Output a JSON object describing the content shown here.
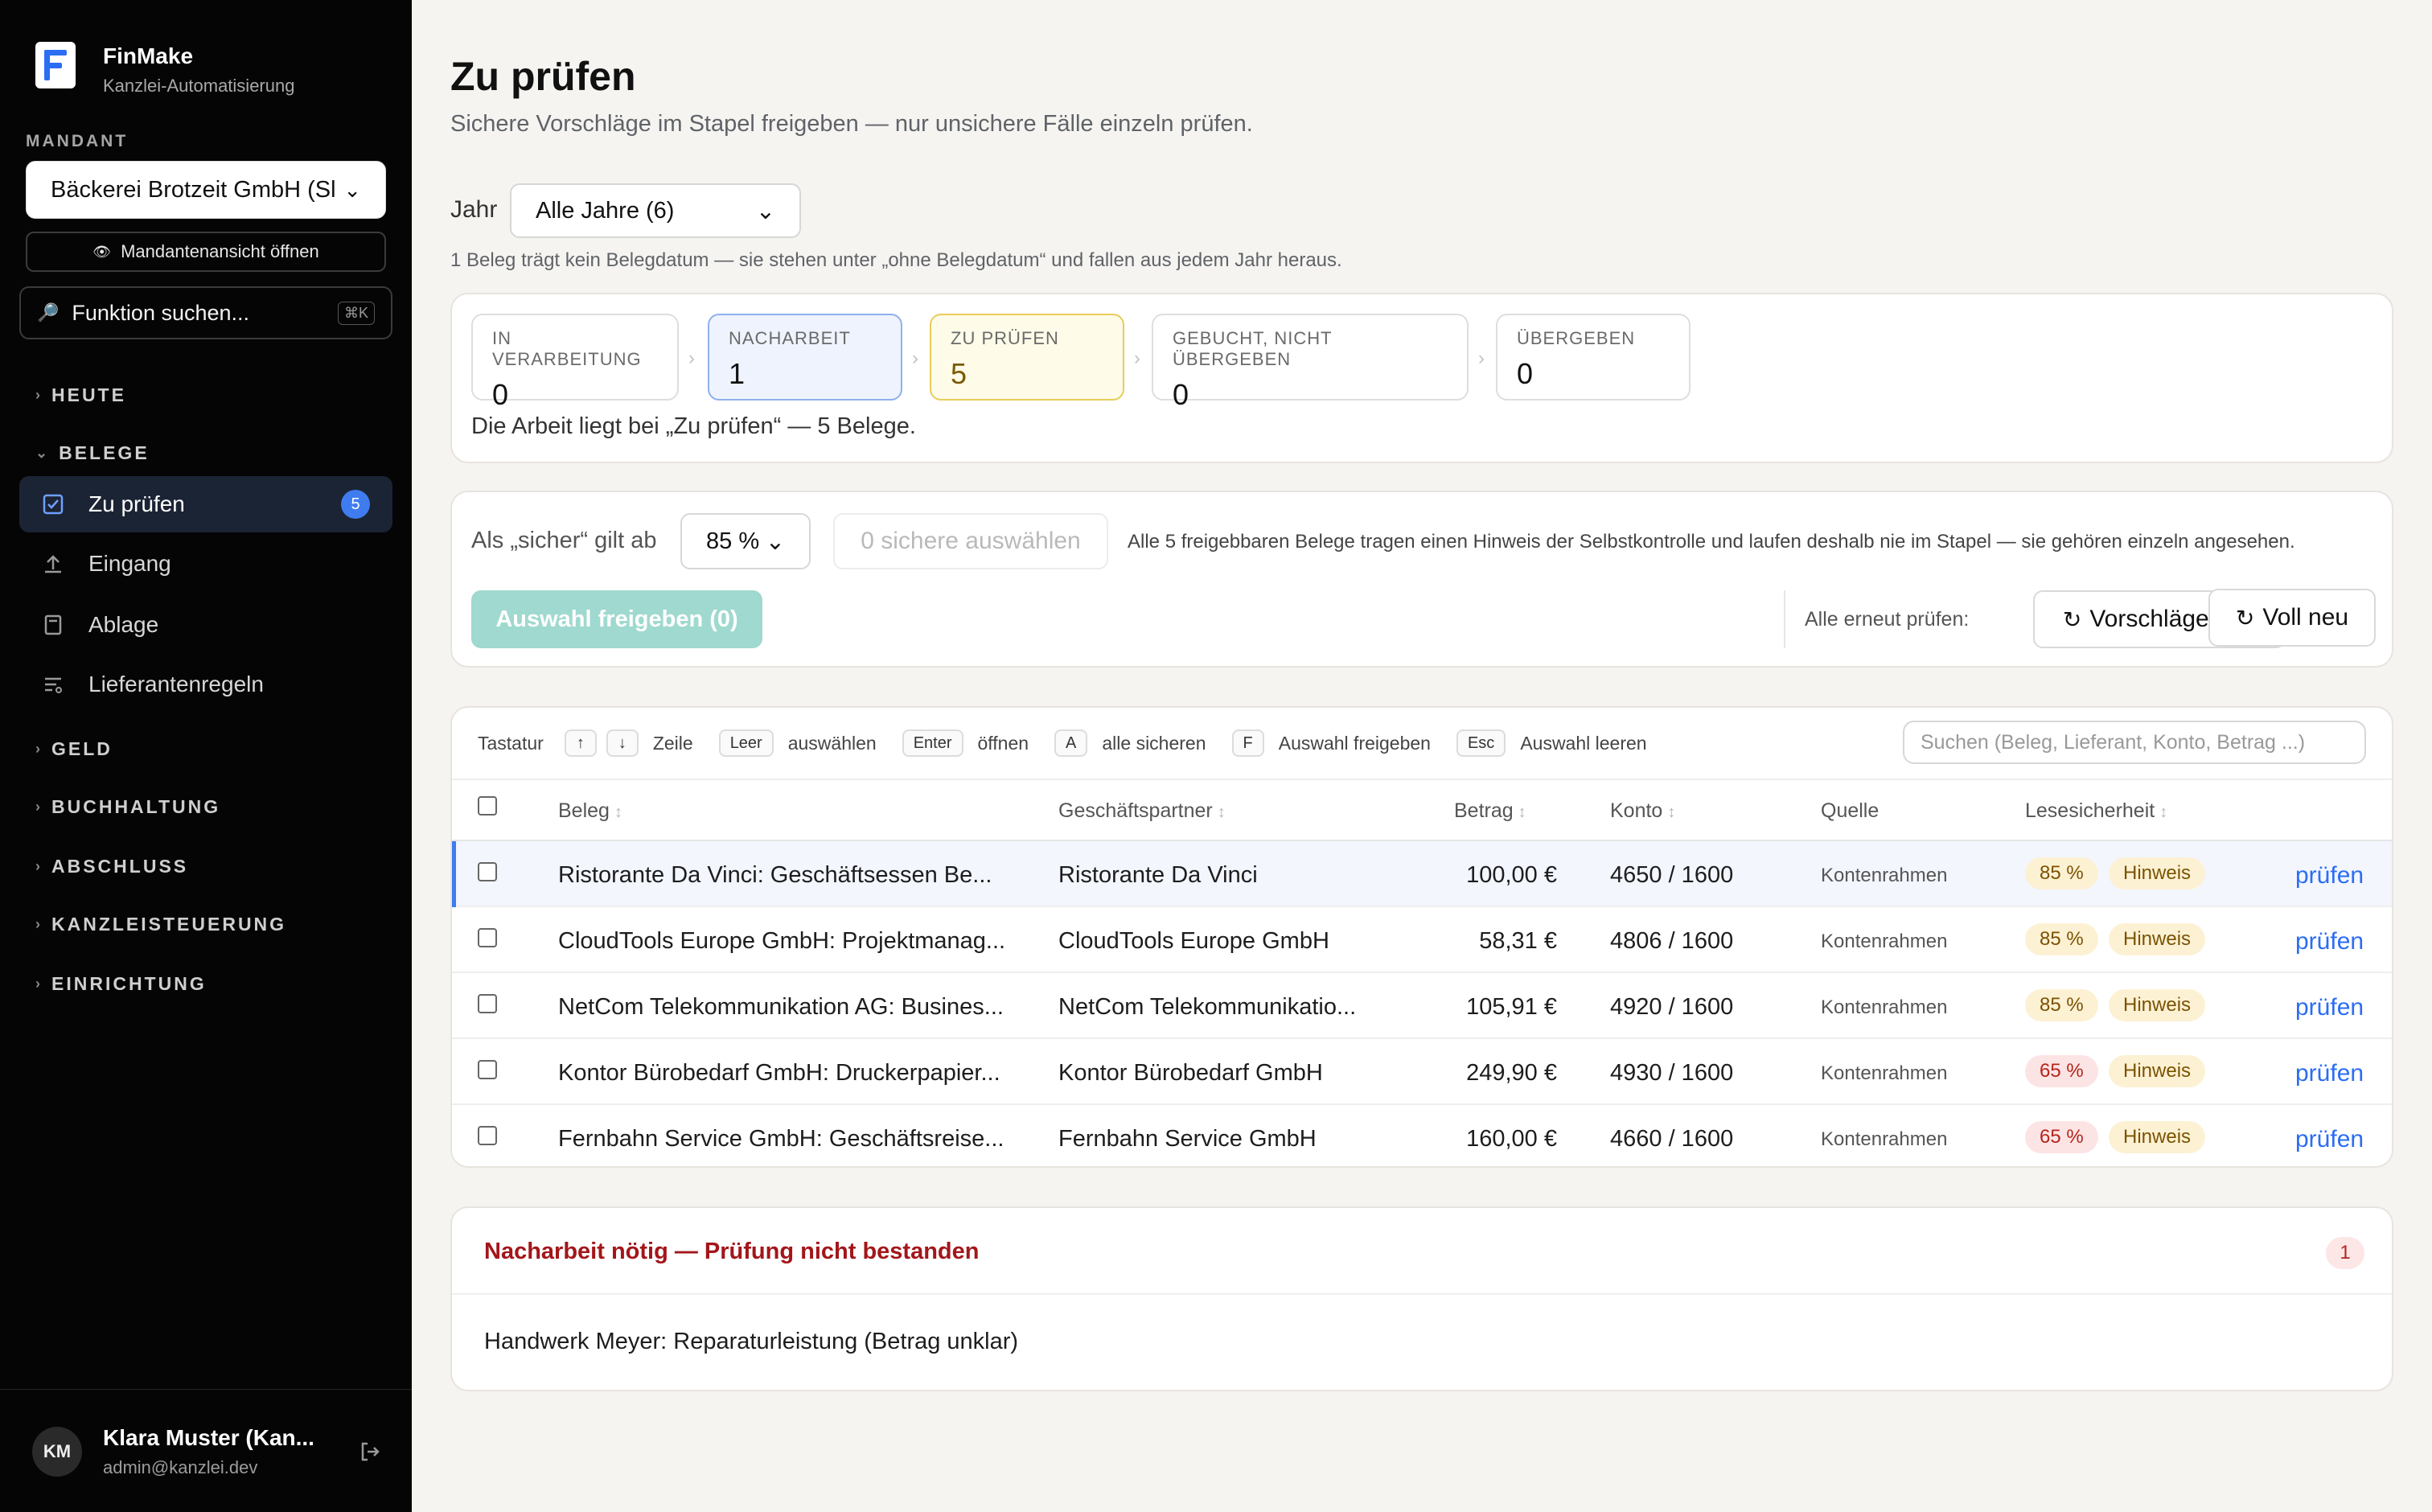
{
  "brand": {
    "name": "FinMake",
    "subtitle": "Kanzlei-Automatisierung"
  },
  "sidebar": {
    "client_label": "MANDANT",
    "client_value": "Bäckerei Brotzeit GmbH (Sl",
    "client_open": "Mandantenansicht öffnen",
    "search_placeholder": "Funktion suchen...",
    "search_shortcut": "⌘K",
    "groups": {
      "heute": "HEUTE",
      "belege": "BELEGE",
      "geld": "GELD",
      "buchhaltung": "BUCHHALTUNG",
      "abschluss": "ABSCHLUSS",
      "kanzleisteuerung": "KANZLEISTEUERUNG",
      "einrichtung": "EINRICHTUNG"
    },
    "items": [
      {
        "label": "Zu prüfen",
        "badge": "5",
        "icon": "checkbox-icon"
      },
      {
        "label": "Eingang",
        "icon": "upload-icon"
      },
      {
        "label": "Ablage",
        "icon": "archive-icon"
      },
      {
        "label": "Lieferantenregeln",
        "icon": "rules-icon"
      }
    ],
    "user": {
      "initials": "KM",
      "name": "Klara Muster (Kan...",
      "email": "admin@kanzlei.dev"
    }
  },
  "main": {
    "title": "Zu prüfen",
    "subtitle": "Sichere Vorschläge im Stapel freigeben — nur unsichere Fälle einzeln prüfen.",
    "year_label": "Jahr",
    "year_value": "Alle Jahre (6)",
    "year_note": "1 Beleg trägt kein Belegdatum — sie stehen unter „ohne Belegdatum“ und fallen aus jedem Jahr heraus.",
    "pipeline": {
      "stages": [
        {
          "label": "IN VERARBEITUNG",
          "value": "0"
        },
        {
          "label": "NACHARBEIT",
          "value": "1"
        },
        {
          "label": "ZU PRÜFEN",
          "value": "5"
        },
        {
          "label": "GEBUCHT, NICHT ÜBERGEBEN",
          "value": "0"
        },
        {
          "label": "ÜBERGEBEN",
          "value": "0"
        }
      ],
      "arrow": "›",
      "note": "Die Arbeit liegt bei „Zu prüfen“ — 5 Belege."
    },
    "batch": {
      "threshold_label": "Als „sicher“ gilt ab",
      "threshold_value": "85 %",
      "select_safe": "0 sichere auswählen",
      "note": "Alle 5 freigebbaren Belege tragen einen Hinweis der Selbstkontrolle und laufen deshalb nie im Stapel — sie gehören einzeln angesehen.",
      "approve": "Auswahl freigeben (0)",
      "recheck_label": "Alle erneut prüfen:",
      "recheck_suggestions": "Vorschläge neu",
      "recheck_full": "Voll neu",
      "recheck_icon": "↻"
    },
    "keyboard": {
      "label": "Tastatur",
      "up": "↑",
      "down": "↓",
      "row": "Zeile",
      "space": "Leer",
      "select": "auswählen",
      "enter": "Enter",
      "open": "öffnen",
      "a": "A",
      "select_all_safe": "alle sicheren",
      "f": "F",
      "approve_selection": "Auswahl freigeben",
      "esc": "Esc",
      "clear_selection": "Auswahl leeren"
    },
    "table_search_placeholder": "Suchen (Beleg, Lieferant, Konto, Betrag ...)",
    "table": {
      "headers": {
        "beleg": "Beleg",
        "partner": "Geschäftspartner",
        "betrag": "Betrag",
        "konto": "Konto",
        "quelle": "Quelle",
        "lesesicherheit": "Lesesicherheit"
      },
      "sort_icon": "↕",
      "rows": [
        {
          "beleg": "Ristorante Da Vinci: Geschäftsessen Be...",
          "partner": "Ristorante Da Vinci",
          "betrag": "100,00 €",
          "konto": "4650 / 1600",
          "quelle": "Kontenrahmen",
          "conf": "85 %",
          "conf_level": "y",
          "hint": "Hinweis",
          "action": "prüfen"
        },
        {
          "beleg": "CloudTools Europe GmbH: Projektmanag...",
          "partner": "CloudTools Europe GmbH",
          "betrag": "58,31 €",
          "konto": "4806 / 1600",
          "quelle": "Kontenrahmen",
          "conf": "85 %",
          "conf_level": "y",
          "hint": "Hinweis",
          "action": "prüfen"
        },
        {
          "beleg": "NetCom Telekommunikation AG: Busines...",
          "partner": "NetCom Telekommunikatio...",
          "betrag": "105,91 €",
          "konto": "4920 / 1600",
          "quelle": "Kontenrahmen",
          "conf": "85 %",
          "conf_level": "y",
          "hint": "Hinweis",
          "action": "prüfen"
        },
        {
          "beleg": "Kontor Bürobedarf GmbH: Druckerpapier...",
          "partner": "Kontor Bürobedarf GmbH",
          "betrag": "249,90 €",
          "konto": "4930 / 1600",
          "quelle": "Kontenrahmen",
          "conf": "65 %",
          "conf_level": "r",
          "hint": "Hinweis",
          "action": "prüfen"
        },
        {
          "beleg": "Fernbahn Service GmbH: Geschäftsreise...",
          "partner": "Fernbahn Service GmbH",
          "betrag": "160,00 €",
          "konto": "4660 / 1600",
          "quelle": "Kontenrahmen",
          "conf": "65 %",
          "conf_level": "r",
          "hint": "Hinweis",
          "action": "prüfen"
        }
      ]
    },
    "rework": {
      "title": "Nacharbeit nötig — Prüfung nicht bestanden",
      "count": "1",
      "items": [
        "Handwerk Meyer: Reparaturleistung (Betrag unklar)"
      ]
    }
  },
  "colors": {
    "accent": "#2b6df3",
    "sidebar_bg": "#050505",
    "approve_disabled": "#9fd9cf",
    "danger": "#a3161a"
  }
}
